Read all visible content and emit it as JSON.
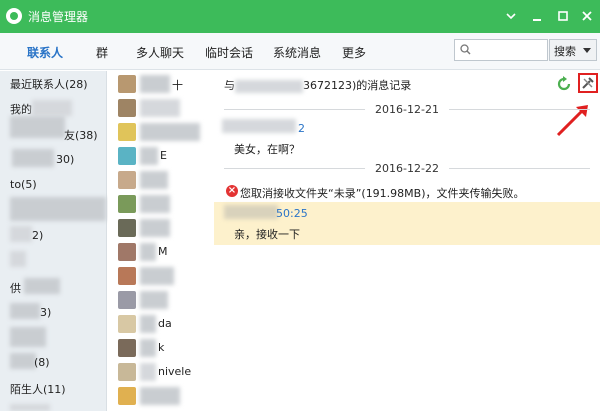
{
  "window": {
    "title": "消息管理器",
    "controls": [
      "chevron-down-icon",
      "minimize-icon",
      "maximize-icon",
      "close-icon"
    ]
  },
  "nav": {
    "items": [
      {
        "label": "联系人",
        "active": true
      },
      {
        "label": "群",
        "active": false
      },
      {
        "label": "多人聊天",
        "active": false
      },
      {
        "label": "临时会话",
        "active": false
      },
      {
        "label": "系统消息",
        "active": false
      },
      {
        "label": "更多",
        "active": false
      }
    ],
    "search": {
      "placeholder": "",
      "value": "",
      "button_label": "搜索"
    }
  },
  "sidebar": {
    "items": [
      {
        "label": "最近联系人(28)"
      },
      {
        "label": "我的"
      },
      {
        "label": "友(38)"
      },
      {
        "label": "30)"
      },
      {
        "label": "to(5)"
      },
      {
        "label": ""
      },
      {
        "label": "2)"
      },
      {
        "label": "3)"
      },
      {
        "label": "供"
      },
      {
        "label": "(3)"
      },
      {
        "label": "(8)"
      },
      {
        "label": "陌生人(11)"
      }
    ]
  },
  "contacts": {
    "items": [
      {
        "name": "十"
      },
      {
        "name": ""
      },
      {
        "name": ""
      },
      {
        "name": "E"
      },
      {
        "name": ""
      },
      {
        "name": ""
      },
      {
        "name": ""
      },
      {
        "name": "M"
      },
      {
        "name": ""
      },
      {
        "name": ""
      },
      {
        "name": "da"
      },
      {
        "name": "k"
      },
      {
        "name": "nivele"
      },
      {
        "name": ""
      }
    ]
  },
  "chat": {
    "header_prefix": "与",
    "header_suffix": "3672123)的消息记录",
    "dates": [
      "2016-12-21",
      "2016-12-22"
    ],
    "messages": [
      {
        "sender_fragment": "2",
        "text": "美女，在啊？"
      },
      {
        "text": "您取消接收文件夹“未录”(191.98MB)，文件夹传输失败。",
        "error": true
      },
      {
        "sender_fragment": "50:25",
        "text": "亲，接收一下",
        "highlight": true
      }
    ]
  },
  "colors": {
    "titlebar": "#3dbb5a",
    "accent_blue": "#2a74c7",
    "error_red": "#e33333",
    "highlight": "#fdf1cc",
    "annotation_red": "#e02020"
  }
}
